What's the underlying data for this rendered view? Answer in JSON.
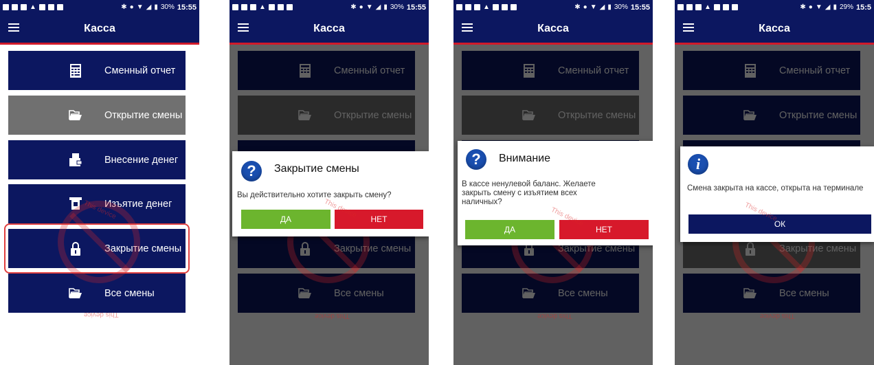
{
  "status_bar": {
    "battery_1": "30%",
    "time_1": "15:55",
    "battery_2": "30%",
    "time_2": "15:55",
    "battery_3": "30%",
    "time_3": "15:55",
    "battery_4": "29%",
    "time_4": "15:5"
  },
  "app_bar": {
    "title": "Касса"
  },
  "menu": {
    "shift_report": "Сменный отчет",
    "open_shift": "Открытие смены",
    "deposit_money": "Внесение денег",
    "withdraw_money": "Изъятие денег",
    "close_shift": "Закрытие смены",
    "all_shifts": "Все смены"
  },
  "dialog_close": {
    "title": "Закрытие смены",
    "message": "Вы действительно хотите закрыть смену?",
    "yes": "ДА",
    "no": "НЕТ"
  },
  "dialog_warning": {
    "title": "Внимание",
    "message": "В кассе ненулевой баланс. Желаете закрыть смену с изъятием всех наличных?",
    "yes": "ДА",
    "no": "НЕТ"
  },
  "dialog_info": {
    "message": "Смена закрыта на кассе, открыта на терминале",
    "ok": "ОК"
  },
  "watermark": {
    "text": "This device",
    "text_flipped": "This device"
  },
  "colors": {
    "navy": "#0c1760",
    "red": "#d11a2a",
    "green": "#6cb52e",
    "gray": "#707070"
  }
}
